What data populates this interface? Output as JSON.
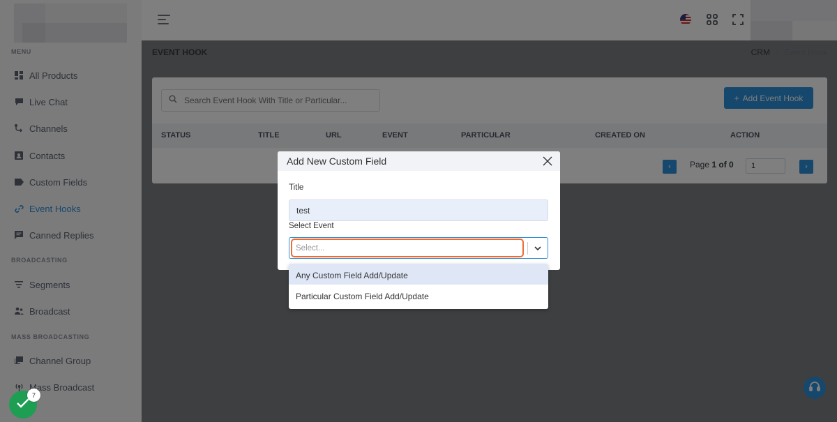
{
  "sidebar": {
    "sections": [
      "MENU",
      "BROADCASTING",
      "MASS BROADCASTING"
    ],
    "items": [
      {
        "label": "All Products",
        "icon": "grid-icon"
      },
      {
        "label": "Live Chat",
        "icon": "chat-icon"
      },
      {
        "label": "Channels",
        "icon": "channels-icon"
      },
      {
        "label": "Contacts",
        "icon": "contact-card-icon"
      },
      {
        "label": "Custom Fields",
        "icon": "tag-icon"
      },
      {
        "label": "Event Hooks",
        "icon": "link-icon",
        "active": true
      },
      {
        "label": "Canned Replies",
        "icon": "message-icon"
      },
      {
        "label": "Segments",
        "icon": "filter-icon"
      },
      {
        "label": "Broadcast",
        "icon": "broadcast-users-icon"
      },
      {
        "label": "Channel Group",
        "icon": "channel-group-icon"
      },
      {
        "label": "Mass Broadcast",
        "icon": "antenna-icon"
      }
    ]
  },
  "header": {
    "page_title": "EVENT HOOK",
    "breadcrumb": [
      "CRM",
      "Event Hook"
    ]
  },
  "toolbar": {
    "search_placeholder": "Search Event Hook With Title or Particular...",
    "add_label": "Add Event Hook"
  },
  "table": {
    "columns": [
      "STATUS",
      "TITLE",
      "URL",
      "EVENT",
      "PARTICULAR",
      "CREATED ON",
      "ACTION"
    ]
  },
  "pagination": {
    "page_word": "Page",
    "page_info": "1 of 0",
    "page_input": "1"
  },
  "modal": {
    "title": "Add New Custom Field",
    "title_label": "Title",
    "title_value": "test",
    "event_label": "Select Event",
    "event_placeholder": "Select...",
    "options": [
      "Any Custom Field Add/Update",
      "Particular Custom Field Add/Update"
    ]
  },
  "checklist": {
    "count": "7"
  },
  "colors": {
    "accent": "#2d8fd8",
    "focus_outline": "#ee6b33",
    "success": "#1d9e52"
  }
}
